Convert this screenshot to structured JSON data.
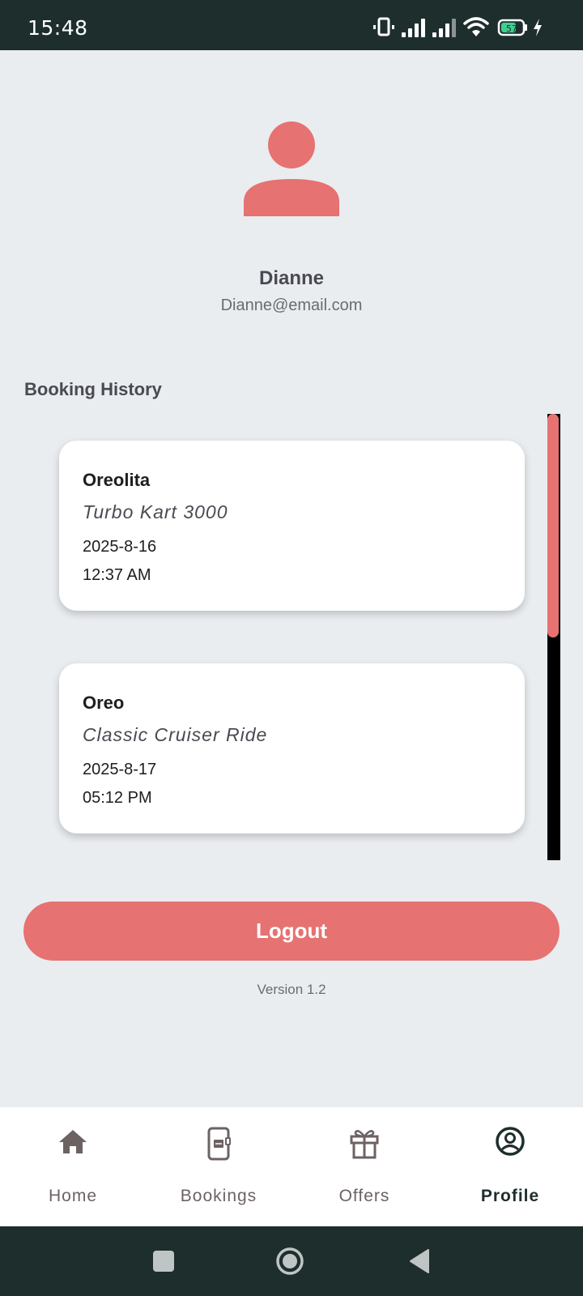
{
  "status_bar": {
    "time": "15:48",
    "battery_level": "57",
    "icons": [
      "vibrate-icon",
      "signal-icon",
      "signal-icon",
      "wifi-icon",
      "battery-icon",
      "charging-icon"
    ]
  },
  "profile": {
    "name": "Dianne",
    "email": "Dianne@email.com",
    "avatar_icon": "person-icon",
    "accent_color": "#e67272"
  },
  "booking_history": {
    "title": "Booking History",
    "bookings": [
      {
        "name": "Oreolita",
        "ride": "Turbo Kart 3000",
        "date": "2025-8-16",
        "time": "12:37 AM"
      },
      {
        "name": "Oreo",
        "ride": "Classic Cruiser Ride",
        "date": "2025-8-17",
        "time": "05:12 PM"
      }
    ]
  },
  "actions": {
    "logout_label": "Logout"
  },
  "footer": {
    "version": "Version 1.2"
  },
  "bottom_nav": {
    "items": [
      {
        "label": "Home",
        "icon": "home-icon",
        "active": false
      },
      {
        "label": "Bookings",
        "icon": "ticket-icon",
        "active": false
      },
      {
        "label": "Offers",
        "icon": "gift-icon",
        "active": false
      },
      {
        "label": "Profile",
        "icon": "account-circle-icon",
        "active": true
      }
    ]
  },
  "system_nav": {
    "buttons": [
      "recents-icon",
      "home-circle-icon",
      "back-icon"
    ]
  }
}
